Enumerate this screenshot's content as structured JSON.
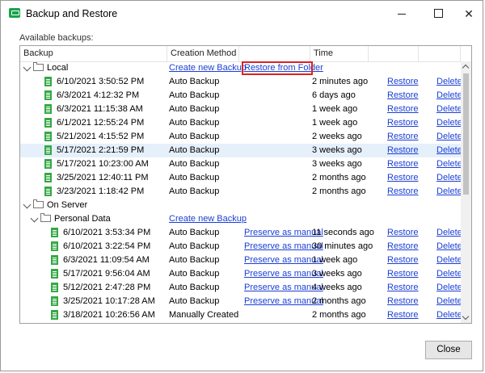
{
  "window": {
    "title": "Backup and Restore",
    "minimize": "—",
    "maximize": "□",
    "close": "✕"
  },
  "available_label": "Available backups:",
  "columns": [
    "Backup",
    "Creation Method",
    "",
    "Time",
    "",
    ""
  ],
  "local": {
    "label": "Local",
    "create_link": "Create new Backup",
    "restore_folder_link": "Restore from Folder",
    "rows": [
      {
        "name": "6/10/2021 3:50:52 PM",
        "method": "Auto Backup",
        "time": "2 minutes ago",
        "restore": "Restore",
        "delete": "Delete"
      },
      {
        "name": "6/3/2021 4:12:32 PM",
        "method": "Auto Backup",
        "time": "6 days ago",
        "restore": "Restore",
        "delete": "Delete"
      },
      {
        "name": "6/3/2021 11:15:38 AM",
        "method": "Auto Backup",
        "time": "1 week ago",
        "restore": "Restore",
        "delete": "Delete"
      },
      {
        "name": "6/1/2021 12:55:24 PM",
        "method": "Auto Backup",
        "time": "1 week ago",
        "restore": "Restore",
        "delete": "Delete"
      },
      {
        "name": "5/21/2021 4:15:52 PM",
        "method": "Auto Backup",
        "time": "2 weeks ago",
        "restore": "Restore",
        "delete": "Delete"
      },
      {
        "name": "5/17/2021 2:21:59 PM",
        "method": "Auto Backup",
        "time": "3 weeks ago",
        "restore": "Restore",
        "delete": "Delete",
        "selected": true
      },
      {
        "name": "5/17/2021 10:23:00 AM",
        "method": "Auto Backup",
        "time": "3 weeks ago",
        "restore": "Restore",
        "delete": "Delete"
      },
      {
        "name": "3/25/2021 12:40:11 PM",
        "method": "Auto Backup",
        "time": "2 months ago",
        "restore": "Restore",
        "delete": "Delete"
      },
      {
        "name": "3/23/2021 1:18:42 PM",
        "method": "Auto Backup",
        "time": "2 months ago",
        "restore": "Restore",
        "delete": "Delete"
      }
    ]
  },
  "server": {
    "label": "On Server",
    "personal": {
      "label": "Personal Data",
      "create_link": "Create new Backup",
      "rows": [
        {
          "name": "6/10/2021 3:53:34 PM",
          "method": "Auto Backup",
          "preserve": "Preserve as manual",
          "time": "11 seconds ago",
          "restore": "Restore",
          "delete": "Delete"
        },
        {
          "name": "6/10/2021 3:22:54 PM",
          "method": "Auto Backup",
          "preserve": "Preserve as manual",
          "time": "30 minutes ago",
          "restore": "Restore",
          "delete": "Delete"
        },
        {
          "name": "6/3/2021 11:09:54 AM",
          "method": "Auto Backup",
          "preserve": "Preserve as manual",
          "time": "1 week ago",
          "restore": "Restore",
          "delete": "Delete"
        },
        {
          "name": "5/17/2021 9:56:04 AM",
          "method": "Auto Backup",
          "preserve": "Preserve as manual",
          "time": "3 weeks ago",
          "restore": "Restore",
          "delete": "Delete"
        },
        {
          "name": "5/12/2021 2:47:28 PM",
          "method": "Auto Backup",
          "preserve": "Preserve as manual",
          "time": "4 weeks ago",
          "restore": "Restore",
          "delete": "Delete"
        },
        {
          "name": "3/25/2021 10:17:28 AM",
          "method": "Auto Backup",
          "preserve": "Preserve as manual",
          "time": "2 months ago",
          "restore": "Restore",
          "delete": "Delete"
        },
        {
          "name": "3/18/2021 10:26:56 AM",
          "method": "Manually Created",
          "preserve": "",
          "time": "2 months ago",
          "restore": "Restore",
          "delete": "Delete"
        }
      ]
    }
  },
  "close_button": "Close",
  "colors": {
    "link": "#1a3fd6",
    "highlight": "#e02020",
    "doc_icon": "#35a845",
    "selected_row": "#e6f0fb"
  }
}
